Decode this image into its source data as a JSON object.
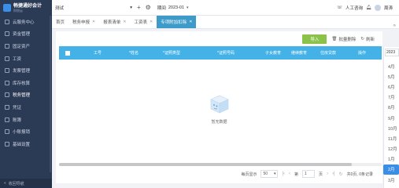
{
  "sidebar": {
    "logo_title": "畅捷通好会计",
    "logo_sub": "财税云",
    "items": [
      {
        "label": "云服务中心"
      },
      {
        "label": "资金管理"
      },
      {
        "label": "固定资产"
      },
      {
        "label": "工资"
      },
      {
        "label": "发票管理"
      },
      {
        "label": "库存核算"
      },
      {
        "label": "税务管理"
      },
      {
        "label": "凭证"
      },
      {
        "label": "账簿"
      },
      {
        "label": "小账报销"
      },
      {
        "label": "基础设置"
      }
    ],
    "bottom_label": "收回导航"
  },
  "topbar": {
    "account": "测试",
    "period_label": "期间",
    "period_value": "2023-01",
    "service": "人工咨询",
    "user": "周涛"
  },
  "tabs": [
    {
      "label": "首页",
      "closable": false
    },
    {
      "label": "税务申报",
      "closable": true
    },
    {
      "label": "报表清单",
      "closable": true
    },
    {
      "label": "工资表",
      "closable": true
    },
    {
      "label": "专项附加扣除",
      "closable": true,
      "active": true
    }
  ],
  "actions": {
    "import": "导入",
    "batch_delete": "批量删除",
    "refresh": "刷新"
  },
  "table": {
    "columns": [
      "工号",
      "*姓名",
      "*证照类型",
      "*证照号码",
      "子女教育",
      "继续教育",
      "住房贷款",
      "操作"
    ]
  },
  "empty_text": "暂无数据",
  "pager": {
    "page_size_label": "每页显示",
    "page_size": "50",
    "page_prefix": "第",
    "page": "1",
    "page_suffix": "页",
    "summary": "共0页, 0条记录"
  },
  "calendar": {
    "year": "2023",
    "months": [
      "4月",
      "5月",
      "6月",
      "7月",
      "8月",
      "9月",
      "10月",
      "11月",
      "12月",
      "1月",
      "2月",
      "3月",
      "4月"
    ],
    "highlight_month_index": 10
  }
}
